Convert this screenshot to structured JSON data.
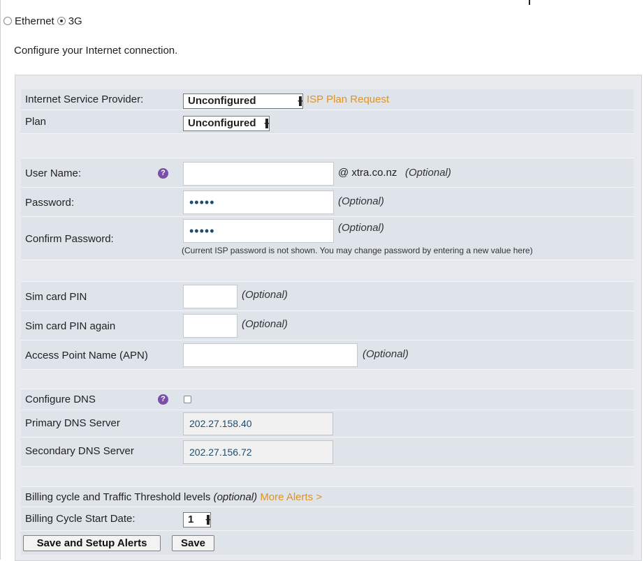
{
  "connection": {
    "options": [
      "Ethernet",
      "3G"
    ],
    "selected": "3G"
  },
  "description": "Configure your Internet connection.",
  "isp": {
    "label": "Internet Service Provider:",
    "value": "Unconfigured",
    "link": "ISP Plan Request"
  },
  "plan": {
    "label": "Plan",
    "value": "Unconfigured"
  },
  "username": {
    "label": "User Name:",
    "value": "",
    "suffix": "@ xtra.co.nz",
    "optional": "(Optional)"
  },
  "password": {
    "label": "Password:",
    "value": "•••••",
    "optional": "(Optional)"
  },
  "confirm_password": {
    "label": "Confirm Password:",
    "value": "•••••",
    "optional": "(Optional)",
    "note": "(Current ISP password is not shown. You may change password by entering a new value here)"
  },
  "sim_pin": {
    "label": "Sim card PIN",
    "value": "",
    "optional": "(Optional)"
  },
  "sim_pin_again": {
    "label": "Sim card PIN again",
    "value": "",
    "optional": "(Optional)"
  },
  "apn": {
    "label": "Access Point Name (APN)",
    "value": "",
    "optional": "(Optional)"
  },
  "configure_dns": {
    "label": "Configure DNS",
    "checked": false
  },
  "primary_dns": {
    "label": "Primary DNS Server",
    "value": "202.27.158.40"
  },
  "secondary_dns": {
    "label": "Secondary DNS Server",
    "value": "202.27.156.72"
  },
  "billing": {
    "heading": "Billing cycle and Traffic Threshold levels",
    "optional": "(optional)",
    "link": "More Alerts >",
    "start_label": "Billing Cycle Start Date:",
    "start_value": "1"
  },
  "buttons": {
    "save_alerts": "Save and Setup Alerts",
    "save": "Save"
  },
  "help_icon": "?",
  "icons": {
    "help": "help-icon",
    "dropdown": "chevron-down-icon"
  },
  "colors": {
    "link": "#e0931f",
    "help": "#7b4fa8",
    "row_bg": "#dfe3ea",
    "input_text": "#1e4c6c"
  }
}
